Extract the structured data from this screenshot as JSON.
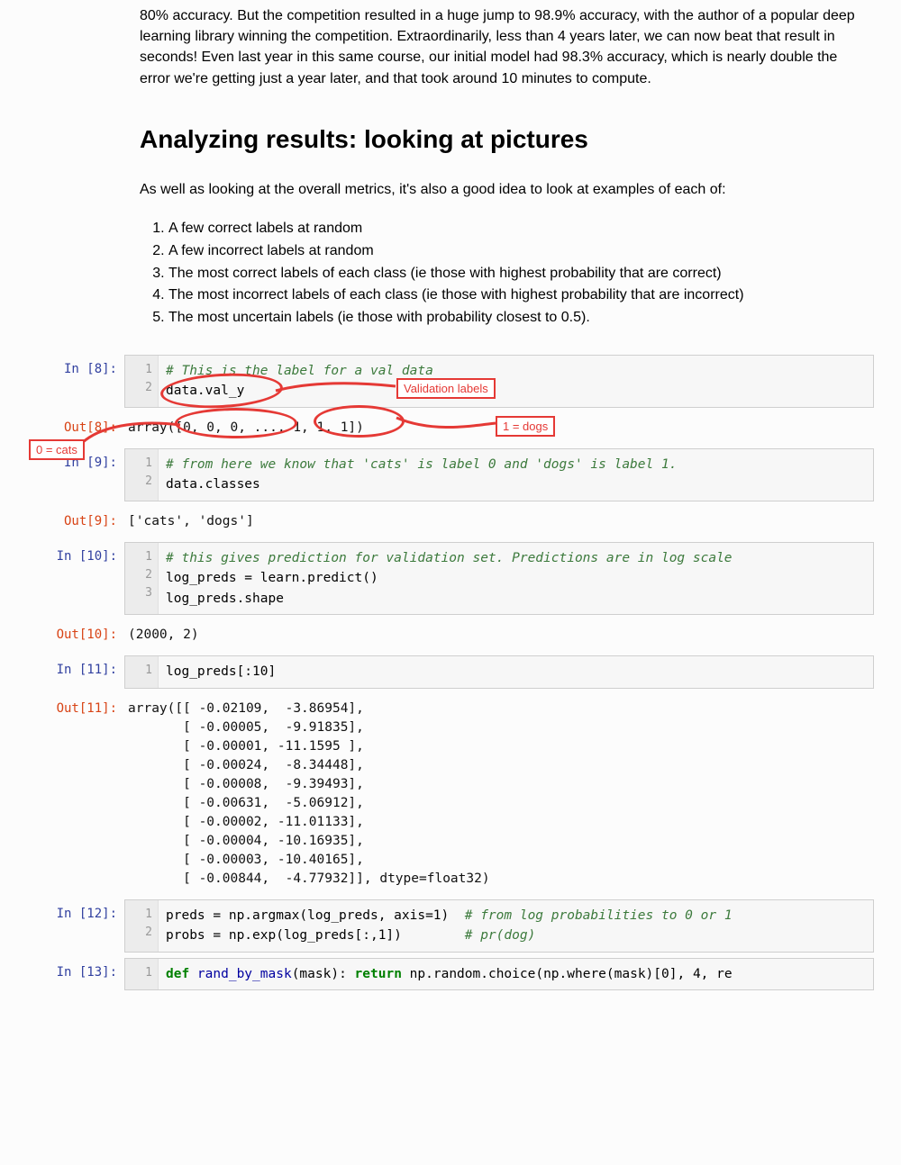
{
  "text": {
    "intro_para": "80% accuracy. But the competition resulted in a huge jump to 98.9% accuracy, with the author of a popular deep learning library winning the competition. Extraordinarily, less than 4 years later, we can now beat that result in seconds! Even last year in this same course, our initial model had 98.3% accuracy, which is nearly double the error we're getting just a year later, and that took around 10 minutes to compute.",
    "heading": "Analyzing results: looking at pictures",
    "lead": "As well as looking at the overall metrics, it's also a good idea to look at examples of each of:",
    "items": [
      "A few correct labels at random",
      "A few incorrect labels at random",
      "The most correct labels of each class (ie those with highest probability that are correct)",
      "The most incorrect labels of each class (ie those with highest probability that are incorrect)",
      "The most uncertain labels (ie those with probability closest to 0.5)."
    ]
  },
  "annotations": {
    "validation_labels": "Validation labels",
    "one_dogs": "1 = dogs",
    "zero_cats": "0 = cats"
  },
  "prompts": {
    "in8": "In [8]:",
    "out8": "Out[8]:",
    "in9": "In [9]:",
    "out9": "Out[9]:",
    "in10": "In [10]:",
    "out10": "Out[10]:",
    "in11": "In [11]:",
    "out11": "Out[11]:",
    "in12": "In [12]:",
    "in13": "In [13]:"
  },
  "cells": {
    "c8": {
      "lines": [
        "1",
        "2"
      ],
      "code": {
        "l1_comment": "# This is the label for a val data",
        "l2": "data.val_y"
      },
      "out": "array([0, 0, 0, ..., 1, 1, 1])"
    },
    "c9": {
      "lines": [
        "1",
        "2"
      ],
      "code": {
        "l1_comment": "# from here we know that 'cats' is label 0 and 'dogs' is label 1.",
        "l2": "data.classes"
      },
      "out": "['cats', 'dogs']"
    },
    "c10": {
      "lines": [
        "1",
        "2",
        "3"
      ],
      "code": {
        "l1_comment": "# this gives prediction for validation set. Predictions are in log scale",
        "l2": "log_preds = learn.predict()",
        "l3": "log_preds.shape"
      },
      "out": "(2000, 2)"
    },
    "c11": {
      "lines": [
        "1"
      ],
      "code": {
        "l1": "log_preds[:10]"
      },
      "out": "array([[ -0.02109,  -3.86954],\n       [ -0.00005,  -9.91835],\n       [ -0.00001, -11.1595 ],\n       [ -0.00024,  -8.34448],\n       [ -0.00008,  -9.39493],\n       [ -0.00631,  -5.06912],\n       [ -0.00002, -11.01133],\n       [ -0.00004, -10.16935],\n       [ -0.00003, -10.40165],\n       [ -0.00844,  -4.77932]], dtype=float32)"
    },
    "c12": {
      "lines": [
        "1",
        "2"
      ],
      "code": {
        "l1_code": "preds = np.argmax(log_preds, axis=1)  ",
        "l1_comment": "# from log probabilities to 0 or 1",
        "l2_code": "probs = np.exp(log_preds[:,1])        ",
        "l2_comment": "# pr(dog)"
      }
    },
    "c13": {
      "lines": [
        "1"
      ],
      "code": {
        "kw_def": "def",
        "fname": " rand_by_mask",
        "sig1": "(mask): ",
        "kw_return": "return",
        "body": " np.random.choice(np.where(mask)[0], 4, re"
      }
    }
  }
}
